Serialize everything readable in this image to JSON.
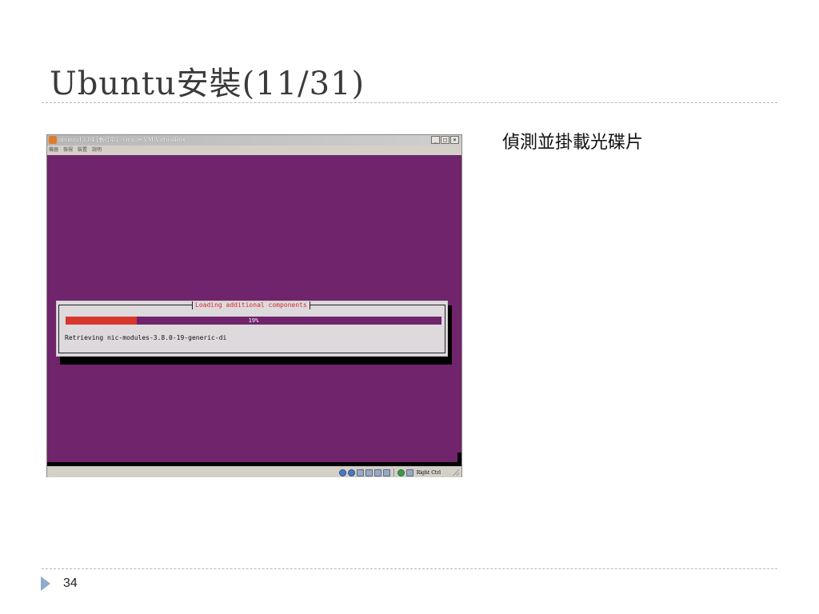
{
  "slide": {
    "title": "Ubuntu安裝(11/31)",
    "bullet": "偵測並掛載光碟片",
    "page_number": "34"
  },
  "window": {
    "title": "ubuntu13.04 [執行中] - Oracle VM VirtualBox",
    "min_glyph": "_",
    "max_glyph": "□",
    "close_glyph": "×",
    "menu": [
      "機器",
      "檢視",
      "裝置",
      "說明"
    ],
    "host_key": "Right Ctrl"
  },
  "installer": {
    "dialog_title": "Loading additional components",
    "progress_percent": 19,
    "progress_label": "19%",
    "status_text": "Retrieving nic-modules-3.8.0-19-generic-di"
  },
  "colors": {
    "ubuntu_purple": "#6f246c",
    "progress_red": "#d6372c",
    "dialog_bg": "#ddd9dd",
    "page_marker": "#8eaacd"
  },
  "icons": [
    "hdd-icon",
    "optical-drive-icon",
    "usb-icon",
    "shared-folder-icon",
    "display-icon",
    "capture-icon",
    "network-icon",
    "mouse-integration-icon"
  ]
}
